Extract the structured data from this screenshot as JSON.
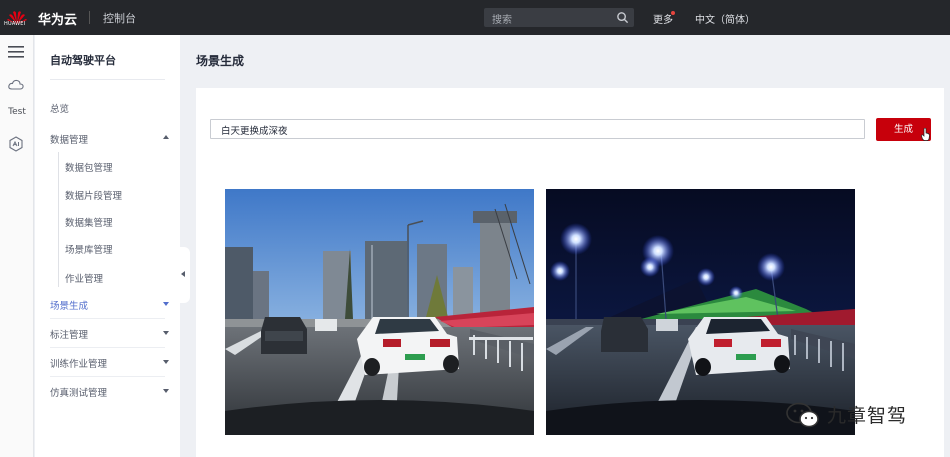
{
  "topbar": {
    "logo_text": "HUAWEI",
    "brand": "华为云",
    "console": "控制台",
    "search_placeholder": "搜索",
    "more": "更多",
    "language": "中文（简体）"
  },
  "rail": {
    "test_label": "Test"
  },
  "sidebar": {
    "title": "自动驾驶平台",
    "items": [
      {
        "label": "总览"
      },
      {
        "label": "数据管理",
        "expanded": true
      },
      {
        "label": "场景生成",
        "active": true
      },
      {
        "label": "标注管理"
      },
      {
        "label": "训练作业管理"
      },
      {
        "label": "仿真测试管理"
      }
    ],
    "sub_items": [
      {
        "label": "数据包管理"
      },
      {
        "label": "数据片段管理"
      },
      {
        "label": "数据集管理"
      },
      {
        "label": "场景库管理"
      },
      {
        "label": "作业管理"
      }
    ]
  },
  "main": {
    "page_title": "场景生成",
    "prompt_value": "白天更换成深夜",
    "generate_button": "生成"
  },
  "watermark": {
    "text": "九章智驾"
  },
  "colors": {
    "topbar": "#25272b",
    "accent_red": "#c7000b",
    "active_blue": "#526ecc",
    "background": "#eef0f4"
  },
  "icons": [
    "huawei-logo",
    "search-icon",
    "menu-icon",
    "cloud-icon",
    "ai-icon",
    "caret-icon",
    "collapse-icon",
    "cursor-icon",
    "wechat-icon"
  ]
}
